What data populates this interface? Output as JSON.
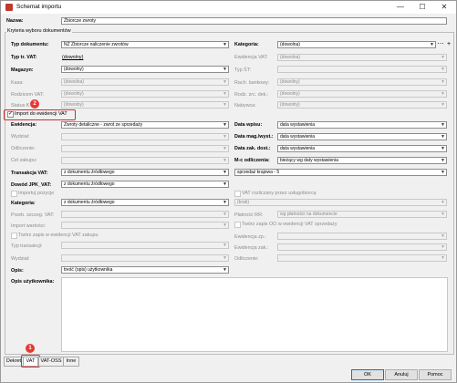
{
  "window": {
    "title": "Schemat importu",
    "minimize": "—",
    "maximize": "☐",
    "close": "✕"
  },
  "header": {
    "name_label": "Nazwa:",
    "name_value": "Zbiorcze zwroty"
  },
  "group_label": "Kryteria wyboru dokumentów",
  "criteria": {
    "doc_type_label": "Typ dokumentu:",
    "doc_type_value": "NZ Zbiorcze naliczenie zwrotów",
    "vat_type_label": "Typ tr. VAT:",
    "vat_type_value": "(dowolny)",
    "warehouse_label": "Magazyn:",
    "warehouse_value": "(dowolny)",
    "cash_label": "Kasa:",
    "cash_value": "(dowolna)",
    "vat_reg_label": "Rodzicem VAT:",
    "vat_reg_value": "(dowolny)",
    "status_label": "Status K",
    "status_value": "(dowolny)",
    "category_label": "Kategoria:",
    "category_value": "(dowolna)",
    "vat_records_label": "Ewidencja VAT:",
    "vat_records_value": "(dowolna)",
    "st_type_label": "Typ ŚT:",
    "st_type_value": "",
    "bank_label": "Rach. bankowy:",
    "bank_value": "(dowolny)",
    "settlement_label": "Rodz. zrc. dek.:",
    "settlement_value": "(dowolny)",
    "buyer_label": "Nabywca:",
    "buyer_value": "(dowolny)"
  },
  "import_vat": {
    "label": "Import do ewidencji VAT",
    "checked": true
  },
  "vat": {
    "records_label": "Ewidencja:",
    "records_value": "Zwroty detaliczne - zwrot ze sprzedaży",
    "dept_label": "Wydział:",
    "receiver_label": "Odliczenie:",
    "purpose_label": "Cel zakupu:",
    "transaction_label": "Transakcja VAT:",
    "transaction_value": "z dokumentu źródłowego",
    "jpk_label": "Dowód JPK_VAT:",
    "jpk_value": "z dokumentu źródłowego",
    "position_label": "Importuj pozycje",
    "category_label": "Kategoria:",
    "category_value": "z dokumentu źródłowego",
    "proxy_label": "Przeb. szczeg. VAT:",
    "import_value_label": "Import wartości:",
    "create_record_label": "Twórz zapis w ewidencji VAT zakupu",
    "transaction_type_label": "Typ transakcji:",
    "dept2_label": "Wydział:",
    "date_issue_label": "Data wpisu:",
    "date_issue_value": "data wystawienia",
    "date_mag_label": "Data mag./wyst.:",
    "date_mag_value": "data wystawienia",
    "date_doc_label": "Data zak. dost.:",
    "date_doc_value": "data wystawienia",
    "month_label": "M-c odliczenia:",
    "month_value": "bieżący wg daty wystawienia",
    "country_value": "sprzedaż krajowa - 5",
    "vat_paid_label": "VAT rozliczany przez usługobiorcę",
    "kind_value": "(brak)",
    "payment_label": "Płatność RR:",
    "payment_value": "wg płatności na dokumencie",
    "create_oo_label": "Twórz zapis OO w ewidencji VAT sprzedaży",
    "records2_label": "Ewidencja zp.:",
    "records3_label": "Ewidencja zak.:",
    "deduct_label": "Odliczenie:",
    "desc_label": "Opis:",
    "desc_value": "treść (opis) użytkownika",
    "user_desc_label": "Opis użytkownika:"
  },
  "tabs": [
    "Dekret",
    "VAT",
    "VAT-OSS",
    "Inne"
  ],
  "buttons": {
    "ok": "OK",
    "cancel": "Anuluj",
    "help": "Pomoc"
  },
  "annotations": {
    "badge1": "1",
    "badge2": "2"
  },
  "colors": {
    "annotation": "#d32f2f",
    "badge": "#e53935"
  }
}
